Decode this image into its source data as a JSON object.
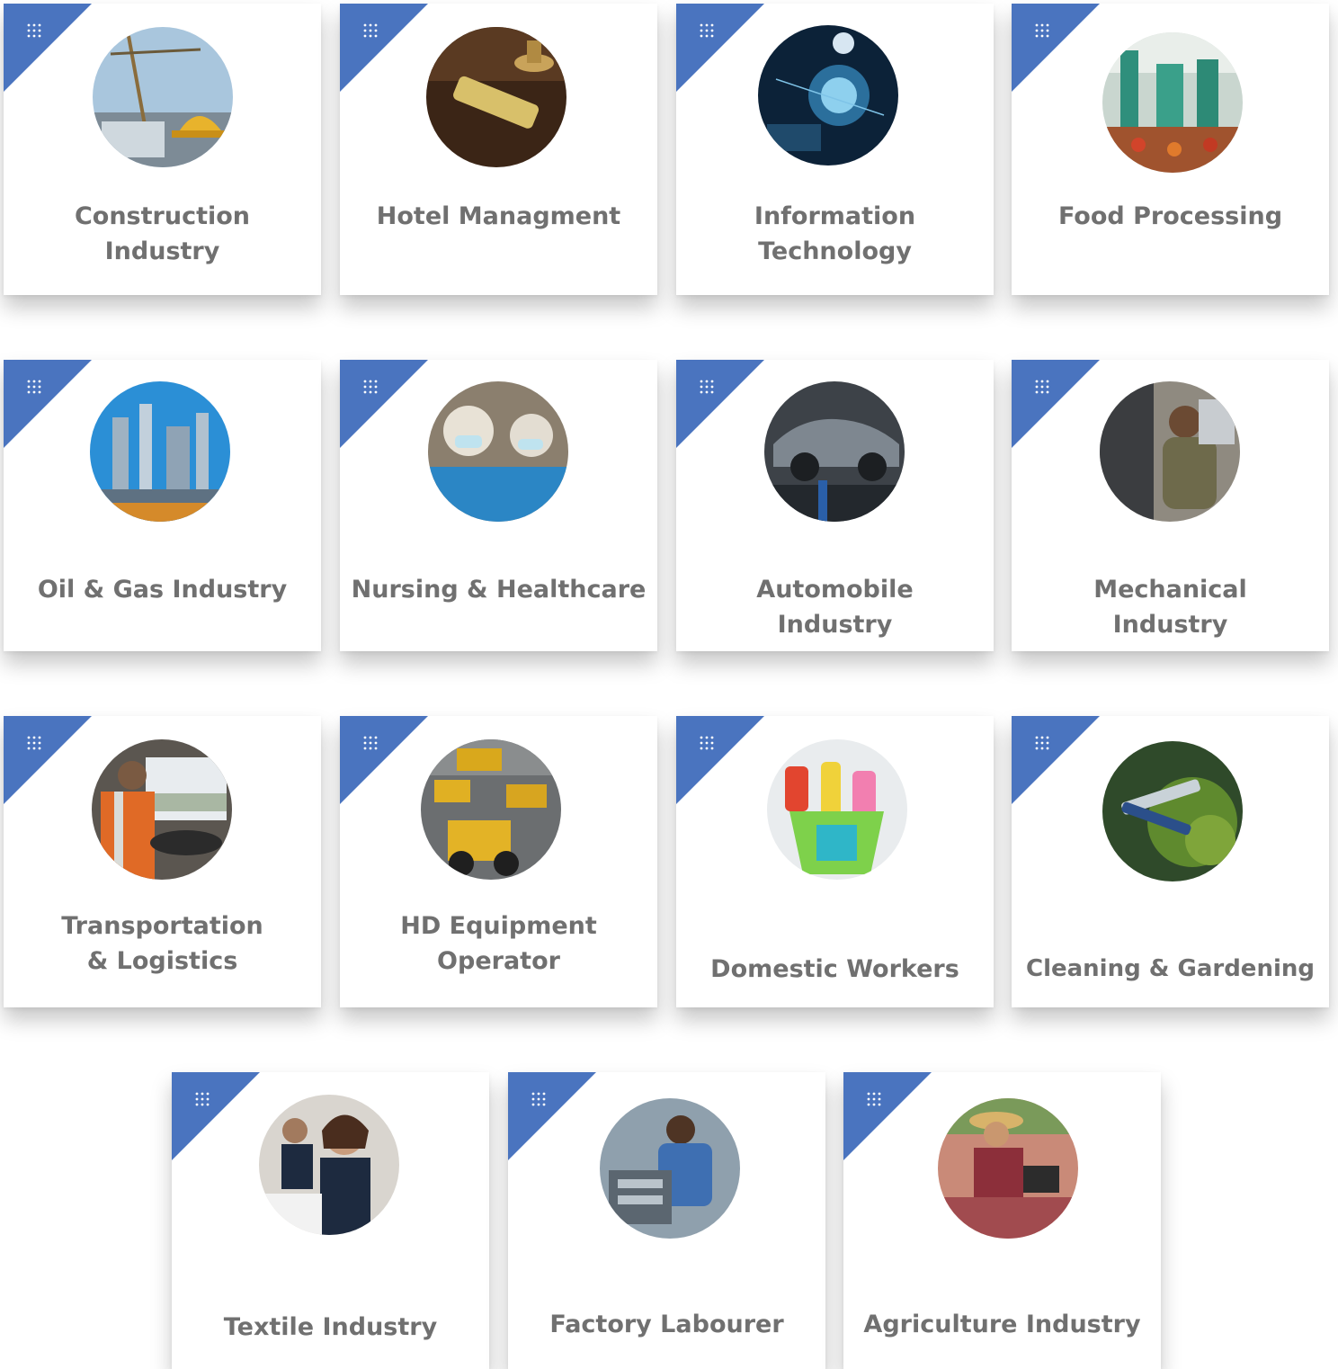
{
  "accent_color": "#4a74bf",
  "label_color": "#707070",
  "cards": [
    {
      "title_line1": "Construction",
      "title_line2": "Industry",
      "icon": "construction-photo"
    },
    {
      "title_line1": "Hotel Managment",
      "title_line2": "",
      "icon": "hotel-photo"
    },
    {
      "title_line1": "Information",
      "title_line2": "Technology",
      "icon": "it-photo"
    },
    {
      "title_line1": "Food Processing",
      "title_line2": "",
      "icon": "food-processing-photo"
    },
    {
      "title_line1": "Oil & Gas Industry",
      "title_line2": "",
      "icon": "oil-gas-photo"
    },
    {
      "title_line1": "Nursing & Healthcare",
      "title_line2": "",
      "icon": "nursing-photo"
    },
    {
      "title_line1": "Automobile",
      "title_line2": "Industry",
      "icon": "automobile-photo"
    },
    {
      "title_line1": "Mechanical",
      "title_line2": "Industry",
      "icon": "mechanical-photo"
    },
    {
      "title_line1": "Transportation",
      "title_line2": "& Logistics",
      "icon": "transportation-photo"
    },
    {
      "title_line1": "HD Equipment",
      "title_line2": "Operator",
      "icon": "hd-equipment-photo"
    },
    {
      "title_line1": "Domestic Workers",
      "title_line2": "",
      "icon": "domestic-workers-photo"
    },
    {
      "title_line1": "Cleaning & Gardening",
      "title_line2": "",
      "icon": "gardening-photo"
    },
    {
      "title_line1": "Textile Industry",
      "title_line2": "",
      "icon": "textile-photo"
    },
    {
      "title_line1": "Factory Labourer",
      "title_line2": "",
      "icon": "factory-photo"
    },
    {
      "title_line1": "Agriculture Industry",
      "title_line2": "",
      "icon": "agriculture-photo"
    }
  ]
}
